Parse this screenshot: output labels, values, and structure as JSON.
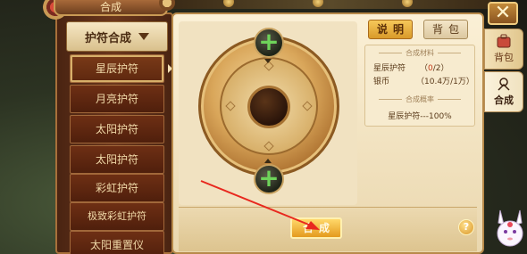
{
  "window": {
    "title": "合成"
  },
  "sidebar": {
    "dropdown_label": "护符合成",
    "items": [
      {
        "label": "星辰护符",
        "selected": true
      },
      {
        "label": "月亮护符",
        "selected": false
      },
      {
        "label": "太阳护符",
        "selected": false
      },
      {
        "label": "太阳护符",
        "selected": false
      },
      {
        "label": "彩虹护符",
        "selected": false
      },
      {
        "label": "极致彩虹护符",
        "selected": false
      },
      {
        "label": "太阳重置仪",
        "selected": false
      }
    ]
  },
  "synthesis": {
    "top_slot_icon": "plus-icon",
    "bottom_slot_icon": "plus-icon"
  },
  "toolbar": {
    "description_label": "说明",
    "bag_label": "背包"
  },
  "materials": {
    "section_title": "合成材料",
    "rows": [
      {
        "name": "星辰护符",
        "value_prefix": "（",
        "value_current": "0",
        "value_suffix": "/2）"
      },
      {
        "name": "银币",
        "value_prefix": "（",
        "value_current": "10.4万",
        "value_suffix": "/1万）"
      }
    ]
  },
  "probability": {
    "section_title": "合成概率",
    "line": "星辰护符---100%"
  },
  "actions": {
    "compose_label": "合成",
    "help_label": "?"
  },
  "right_tabs": {
    "close_label": "✕",
    "bag_label": "背包",
    "compose_label": "合成"
  },
  "colors": {
    "accent_gold": "#e49a1e",
    "plus_green": "#6ed45a",
    "material_red": "#c23a1a",
    "annotation_arrow": "#e8281e"
  }
}
